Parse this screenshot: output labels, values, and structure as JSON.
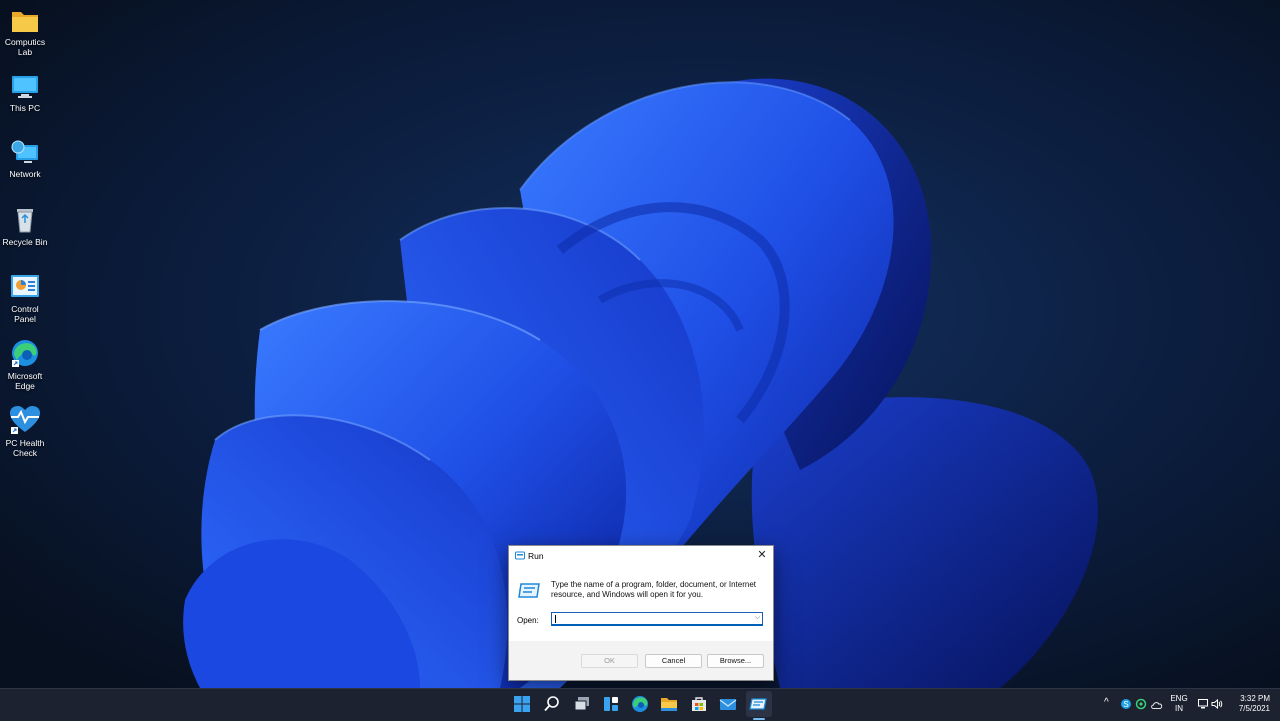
{
  "desktop": {
    "icons": [
      {
        "label": "Computics Lab",
        "icon": "folder-icon"
      },
      {
        "label": "This PC",
        "icon": "monitor-icon"
      },
      {
        "label": "Network",
        "icon": "network-icon"
      },
      {
        "label": "Recycle Bin",
        "icon": "recycle-bin-icon"
      },
      {
        "label": "Control Panel",
        "icon": "control-panel-icon"
      },
      {
        "label": "Microsoft Edge",
        "icon": "edge-icon"
      },
      {
        "label": "PC Health Check",
        "icon": "pc-health-check-icon"
      }
    ]
  },
  "run_dialog": {
    "title": "Run",
    "description": "Type the name of a program, folder, document, or Internet resource, and Windows will open it for you.",
    "open_label": "Open:",
    "open_value": "",
    "ok_label": "OK",
    "cancel_label": "Cancel",
    "browse_label": "Browse..."
  },
  "taskbar": {
    "apps": [
      "start-icon",
      "search-icon",
      "task-view-icon",
      "widgets-icon",
      "edge-icon",
      "file-explorer-icon",
      "store-icon",
      "mail-icon",
      "run-icon"
    ],
    "tray": {
      "language_line1": "ENG",
      "language_line2": "IN",
      "time": "3:32 PM",
      "date": "7/5/2021"
    }
  },
  "colors": {
    "accent": "#005fb8",
    "taskbar": "#1c2230",
    "wallpaper_dark": "#0a1630",
    "bloom_blue": "#1e4fe0"
  }
}
